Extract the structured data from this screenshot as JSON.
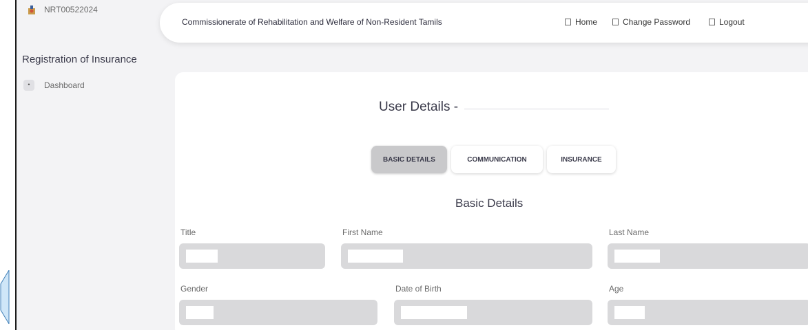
{
  "app": {
    "user_code": "NRT00522024",
    "header_title": "Commissionerate of Rehabilitation and Welfare of Non-Resident Tamils"
  },
  "nav": {
    "home": "Home",
    "change_password": "Change Password",
    "logout": "Logout"
  },
  "sidebar": {
    "title": "Registration of Insurance",
    "items": [
      {
        "label": "Dashboard",
        "bullet": "•"
      }
    ]
  },
  "main": {
    "heading": "User Details -",
    "tabs": [
      {
        "label": "BASIC DETAILS",
        "active": true
      },
      {
        "label": "COMMUNICATION",
        "active": false
      },
      {
        "label": "INSURANCE",
        "active": false
      }
    ],
    "section_title": "Basic Details",
    "fields": {
      "title": "Title",
      "first_name": "First Name",
      "last_name": "Last Name",
      "gender": "Gender",
      "dob": "Date of Birth",
      "age": "Age"
    }
  },
  "colors": {
    "page_bg": "#f3f3f5",
    "card_bg": "#ffffff",
    "field_bg": "#d9d9db",
    "active_tab_bg": "#c9c9cb",
    "arrow_fill": "#cfe6f8",
    "arrow_stroke": "#3f7fb8"
  }
}
